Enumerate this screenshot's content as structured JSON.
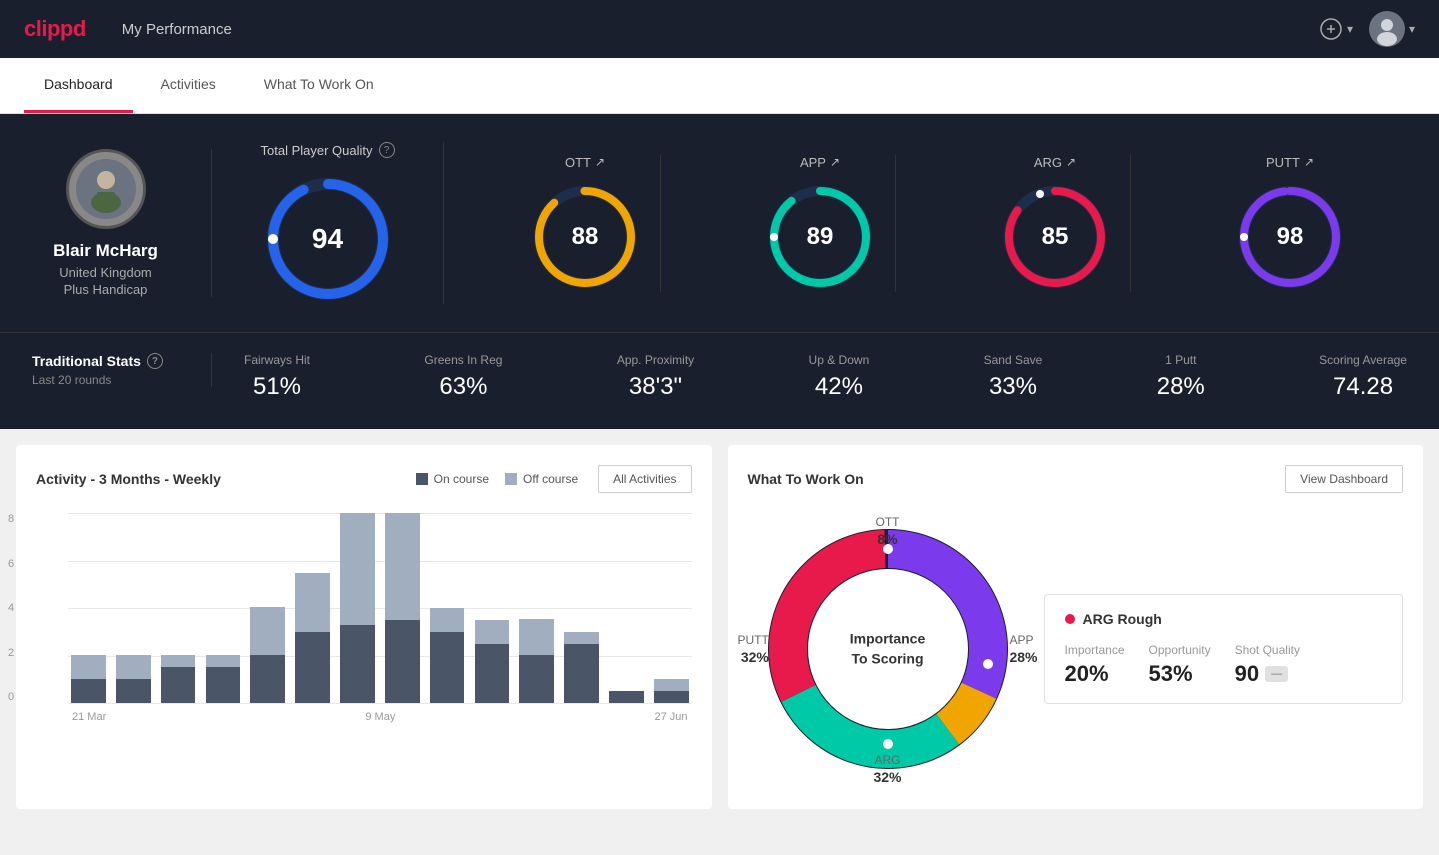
{
  "header": {
    "logo": "clippd",
    "title": "My Performance",
    "add_icon": "⊕",
    "user_icon": "▾"
  },
  "tabs": [
    {
      "id": "dashboard",
      "label": "Dashboard",
      "active": true
    },
    {
      "id": "activities",
      "label": "Activities",
      "active": false
    },
    {
      "id": "what-to-work-on",
      "label": "What To Work On",
      "active": false
    }
  ],
  "player": {
    "name": "Blair McHarg",
    "country": "United Kingdom",
    "handicap": "Plus Handicap"
  },
  "total_quality": {
    "label": "Total Player Quality",
    "value": "94"
  },
  "category_scores": [
    {
      "id": "ott",
      "label": "OTT",
      "value": "88",
      "color": "#f0a500",
      "trend": "↗"
    },
    {
      "id": "app",
      "label": "APP",
      "value": "89",
      "color": "#00c9a7",
      "trend": "↗"
    },
    {
      "id": "arg",
      "label": "ARG",
      "value": "85",
      "color": "#e8194b",
      "trend": "↗"
    },
    {
      "id": "putt",
      "label": "PUTT",
      "value": "98",
      "color": "#7c3aed",
      "trend": "↗"
    }
  ],
  "traditional_stats": {
    "label": "Traditional Stats",
    "sublabel": "Last 20 rounds",
    "items": [
      {
        "id": "fairways-hit",
        "name": "Fairways Hit",
        "value": "51%"
      },
      {
        "id": "greens-in-reg",
        "name": "Greens In Reg",
        "value": "63%"
      },
      {
        "id": "app-proximity",
        "name": "App. Proximity",
        "value": "38'3\""
      },
      {
        "id": "up-down",
        "name": "Up & Down",
        "value": "42%"
      },
      {
        "id": "sand-save",
        "name": "Sand Save",
        "value": "33%"
      },
      {
        "id": "one-putt",
        "name": "1 Putt",
        "value": "28%"
      },
      {
        "id": "scoring-avg",
        "name": "Scoring Average",
        "value": "74.28"
      }
    ]
  },
  "activity_chart": {
    "title": "Activity - 3 Months - Weekly",
    "legend": [
      {
        "id": "on-course",
        "label": "On course",
        "color": "#4a5568"
      },
      {
        "id": "off-course",
        "label": "Off course",
        "color": "#a0aec0"
      }
    ],
    "all_button": "All Activities",
    "x_labels": [
      "21 Mar",
      "9 May",
      "27 Jun"
    ],
    "y_labels": [
      "8",
      "6",
      "4",
      "2",
      "0"
    ],
    "bars": [
      {
        "on": 1,
        "off": 1
      },
      {
        "on": 1,
        "off": 1
      },
      {
        "on": 1.5,
        "off": 0.5
      },
      {
        "on": 1.5,
        "off": 0.5
      },
      {
        "on": 2,
        "off": 2
      },
      {
        "on": 3,
        "off": 2.5
      },
      {
        "on": 3.5,
        "off": 5
      },
      {
        "on": 3.5,
        "off": 4.5
      },
      {
        "on": 3,
        "off": 1
      },
      {
        "on": 2.5,
        "off": 1
      },
      {
        "on": 2,
        "off": 1.5
      },
      {
        "on": 2.5,
        "off": 0.5
      },
      {
        "on": 0.5,
        "off": 0
      },
      {
        "on": 0.5,
        "off": 0.5
      }
    ]
  },
  "what_to_work_on": {
    "title": "What To Work On",
    "view_button": "View Dashboard",
    "donut_label": "Importance\nTo Scoring",
    "segments": [
      {
        "id": "ott",
        "label": "OTT",
        "percent": "8%",
        "color": "#f0a500",
        "value": 8
      },
      {
        "id": "app",
        "label": "APP",
        "percent": "28%",
        "color": "#00c9a7",
        "value": 28
      },
      {
        "id": "arg",
        "label": "ARG",
        "percent": "32%",
        "color": "#e8194b",
        "value": 32
      },
      {
        "id": "putt",
        "label": "PUTT",
        "percent": "32%",
        "color": "#7c3aed",
        "value": 32
      }
    ],
    "detail": {
      "title": "ARG Rough",
      "dot_color": "#e8194b",
      "metrics": [
        {
          "id": "importance",
          "label": "Importance",
          "value": "20%"
        },
        {
          "id": "opportunity",
          "label": "Opportunity",
          "value": "53%"
        },
        {
          "id": "shot-quality",
          "label": "Shot Quality",
          "value": "90",
          "badge": "—"
        }
      ]
    }
  }
}
